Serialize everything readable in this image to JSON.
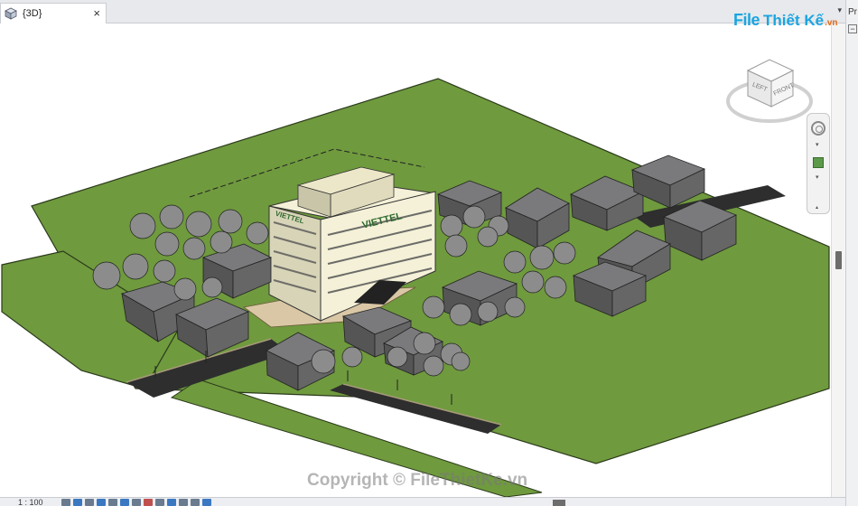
{
  "tab": {
    "title": "{3D}",
    "close": "×",
    "icon": "revit-3d-cube-icon"
  },
  "tab_menu": "▾",
  "right_panel": {
    "label": "Pr",
    "collapse": "−"
  },
  "logo": {
    "file": "File",
    "thiet": "Thiết Kế",
    "vn": ".vn"
  },
  "viewcube": {
    "left": "LEFT",
    "front": "FRONT"
  },
  "building": {
    "sign_front": "VIETTEL",
    "sign_side": "VIETTEL"
  },
  "watermark": "Copyright © FileThietKe.vn",
  "status": {
    "scale": "1 : 100"
  },
  "colors": {
    "grass": "#6f9a3e",
    "road": "#2e2e2e",
    "roof": "#6e6e70",
    "building": "#f4f1d8",
    "accent": "#1aa5e0"
  }
}
